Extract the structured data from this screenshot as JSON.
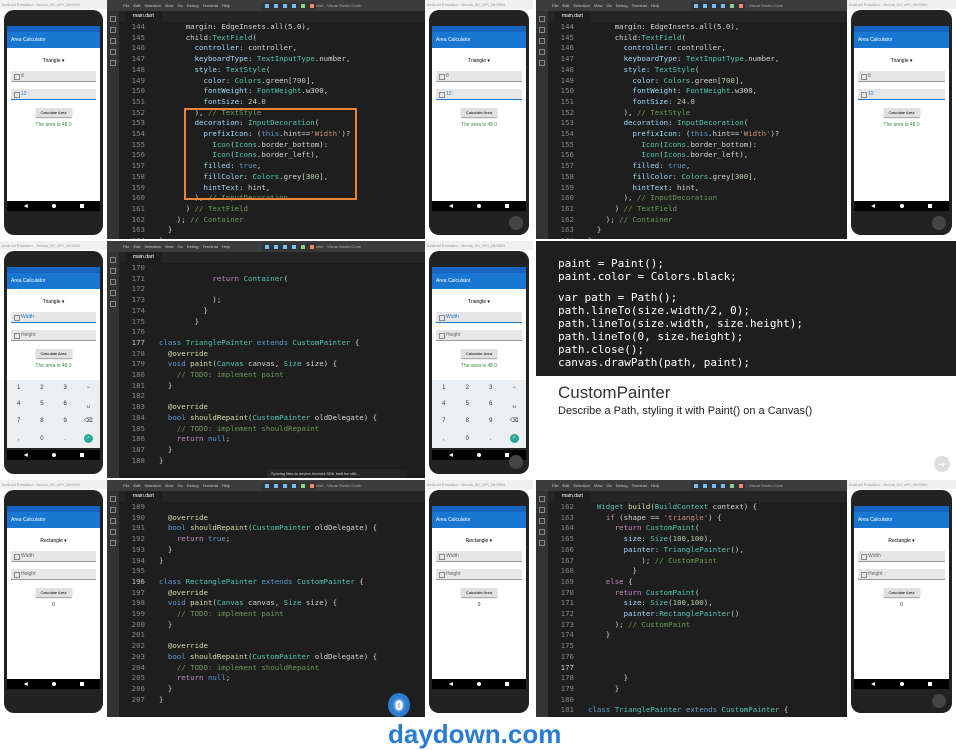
{
  "emulator": {
    "title": "Android Emulator - Nexus_5X_API_28:5554"
  },
  "app": {
    "bar_title": "Area Calculator",
    "calc_button": "Calculate Area",
    "width_hint": "Width",
    "height_hint": "Height"
  },
  "ide": {
    "menu": [
      "File",
      "Edit",
      "Selection",
      "View",
      "Go",
      "Debug",
      "Terminal",
      "Help"
    ],
    "window_title": "main.dart - fl_demo_container - Visual Studio Code",
    "tab": "main.dart",
    "status_sync": "Syncing files to device Android SDK built for x86..."
  },
  "panel1": {
    "shape": "Triangle",
    "field1": "8",
    "field2": "12",
    "result": "The area is 48.0"
  },
  "panel2": {
    "shape": "Triangle",
    "field1": "8",
    "field2": "12",
    "result": "The area is 48.0"
  },
  "panel3": {
    "shape": "Triangle",
    "result": "The area is 48.0",
    "keys": [
      "1",
      "2",
      "3",
      "−",
      "4",
      "5",
      "6",
      "␣",
      "7",
      "8",
      "9",
      "⌫",
      ",",
      "0",
      ".",
      "✓"
    ]
  },
  "panel5": {
    "shape": "Rectangle",
    "result": "0"
  },
  "panel6": {
    "shape": "Rectangle",
    "result": "0"
  },
  "slide": {
    "code": [
      "paint = Paint();",
      "paint.color = Colors.black;",
      "",
      "var path = Path();",
      "path.lineTo(size.width/2, 0);",
      "path.lineTo(size.width, size.height);",
      "path.lineTo(0, size.height);",
      "path.close();",
      "canvas.drawPath(path, paint);"
    ],
    "heading": "CustomPainter",
    "subheading": "Describe a Path, styling it with Paint() on a Canvas()"
  },
  "watermark": "daydown.com"
}
